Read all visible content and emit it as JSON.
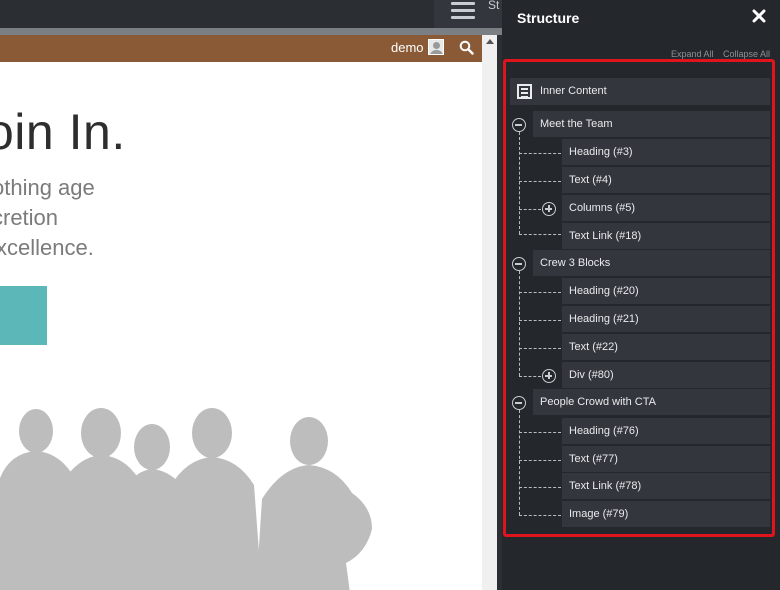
{
  "topbar": {
    "tab_text": "St"
  },
  "site": {
    "user_label": "demo",
    "hero_heading": "oin In.",
    "hero_lines": [
      "othing age",
      "cretion",
      "xcellence."
    ]
  },
  "panel": {
    "title": "Structure",
    "expand_all": "Expand All",
    "collapse_all": "Collapse All",
    "root": "Inner Content",
    "groups": [
      {
        "label": "Meet the Team",
        "children": [
          {
            "label": "Heading (#3)"
          },
          {
            "label": "Text (#4)"
          },
          {
            "label": "Columns (#5)",
            "collapsed": true
          },
          {
            "label": "Text Link (#18)"
          }
        ]
      },
      {
        "label": "Crew 3 Blocks",
        "children": [
          {
            "label": "Heading (#20)"
          },
          {
            "label": "Heading (#21)"
          },
          {
            "label": "Text (#22)"
          },
          {
            "label": "Div (#80)",
            "collapsed": true
          }
        ]
      },
      {
        "label": "People Crowd with CTA",
        "children": [
          {
            "label": "Heading (#76)"
          },
          {
            "label": "Text (#77)"
          },
          {
            "label": "Text Link (#78)"
          },
          {
            "label": "Image (#79)"
          }
        ]
      }
    ]
  },
  "colors": {
    "header_brown": "#8a5a36",
    "cta_teal": "#5cb7b9",
    "highlight_red": "#e0141c",
    "panel_bg": "#24272c",
    "node_bg": "#33363c"
  }
}
